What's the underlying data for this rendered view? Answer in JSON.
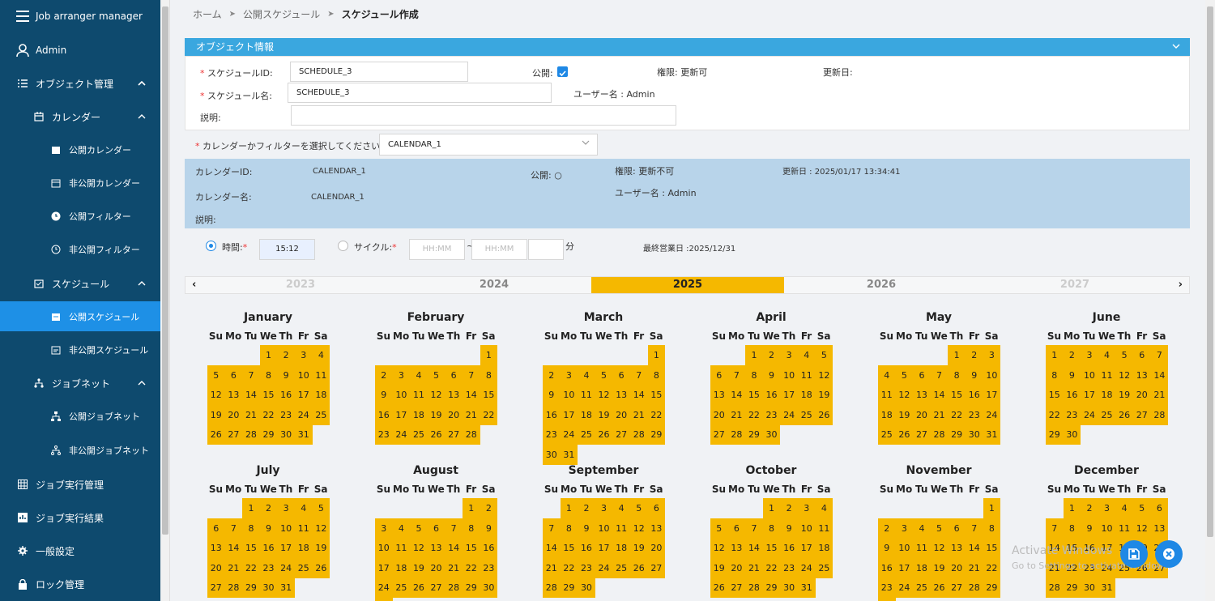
{
  "sidebar": {
    "app_title": "Job arranger manager",
    "user": "Admin",
    "items": [
      {
        "label": "オブジェクト管理",
        "icon": "list-icon"
      },
      {
        "label": "カレンダー",
        "icon": "calendar-icon"
      },
      {
        "label": "公開カレンダー",
        "icon": "calendar-filled-icon"
      },
      {
        "label": "非公開カレンダー",
        "icon": "calendar-outline-icon"
      },
      {
        "label": "公開フィルター",
        "icon": "clock-filled-icon"
      },
      {
        "label": "非公開フィルター",
        "icon": "clock-outline-icon"
      },
      {
        "label": "スケジュール",
        "icon": "schedule-icon"
      },
      {
        "label": "公開スケジュール",
        "icon": "schedule-filled-icon"
      },
      {
        "label": "非公開スケジュール",
        "icon": "schedule-outline-icon"
      },
      {
        "label": "ジョブネット",
        "icon": "network-icon"
      },
      {
        "label": "公開ジョブネット",
        "icon": "network-filled-icon"
      },
      {
        "label": "非公開ジョブネット",
        "icon": "network-outline-icon"
      },
      {
        "label": "ジョブ実行管理",
        "icon": "grid-icon"
      },
      {
        "label": "ジョブ実行結果",
        "icon": "result-icon"
      },
      {
        "label": "一般設定",
        "icon": "gear-icon"
      },
      {
        "label": "ロック管理",
        "icon": "lock-icon"
      }
    ]
  },
  "breadcrumb": {
    "home": "ホーム",
    "sep": "➤",
    "parent": "公開スケジュール",
    "current": "スケジュール作成"
  },
  "object_info": {
    "title": "オブジェクト情報",
    "schedule_id_label": "スケジュールID:",
    "schedule_id_value": "SCHEDULE_3",
    "public_label": "公開:",
    "permission": "権限: 更新可",
    "updated_label": "更新日:",
    "schedule_name_label": "スケジュール名:",
    "schedule_name_value": "SCHEDULE_3",
    "user_name": "ユーザー名 : Admin",
    "desc_label": "説明:",
    "desc_value": ""
  },
  "calendar_select": {
    "label": "カレンダーかフィルターを選択してください:",
    "value": "CALENDAR_1"
  },
  "calendar_info": {
    "id_label": "カレンダーID:",
    "id_value": "CALENDAR_1",
    "public_label": "公開: ",
    "public_value": "○",
    "permission": "権限: 更新不可",
    "updated": "更新日 : 2025/01/17 13:34:41",
    "name_label": "カレンダー名:",
    "name_value": "CALENDAR_1",
    "user_name": "ユーザー名 : Admin",
    "desc_label": "説明:"
  },
  "time": {
    "time_label": "時間:",
    "time_value": "15:12",
    "cycle_label": "サイクル:",
    "hhmm_placeholder": "HH:MM",
    "tilde": "~",
    "minute_label": "分",
    "last_business_day": "最終営業日 :2025/12/31"
  },
  "years": {
    "prev": "‹",
    "next": "›",
    "list": [
      "2023",
      "2024",
      "2025",
      "2026",
      "2027"
    ],
    "selected": "2025"
  },
  "weekdays": [
    "Su",
    "Mo",
    "Tu",
    "We",
    "Th",
    "Fr",
    "Sa"
  ],
  "months": [
    {
      "name": "January",
      "start": 3,
      "days": 31
    },
    {
      "name": "February",
      "start": 6,
      "days": 28
    },
    {
      "name": "March",
      "start": 6,
      "days": 31
    },
    {
      "name": "April",
      "start": 2,
      "days": 30
    },
    {
      "name": "May",
      "start": 4,
      "days": 31
    },
    {
      "name": "June",
      "start": 0,
      "days": 30
    },
    {
      "name": "July",
      "start": 2,
      "days": 31
    },
    {
      "name": "August",
      "start": 5,
      "days": 31
    },
    {
      "name": "September",
      "start": 1,
      "days": 30
    },
    {
      "name": "October",
      "start": 3,
      "days": 31
    },
    {
      "name": "November",
      "start": 6,
      "days": 30
    },
    {
      "name": "December",
      "start": 1,
      "days": 31
    }
  ],
  "colors": {
    "sidebar": "#0e4a6e",
    "active": "#1e90e6",
    "header": "#3aa7df",
    "day": "#f5b800",
    "info": "#b8d4ea"
  },
  "watermark": {
    "line1": "Activate Windows",
    "line2": "Go to Settings to activate Windows."
  }
}
